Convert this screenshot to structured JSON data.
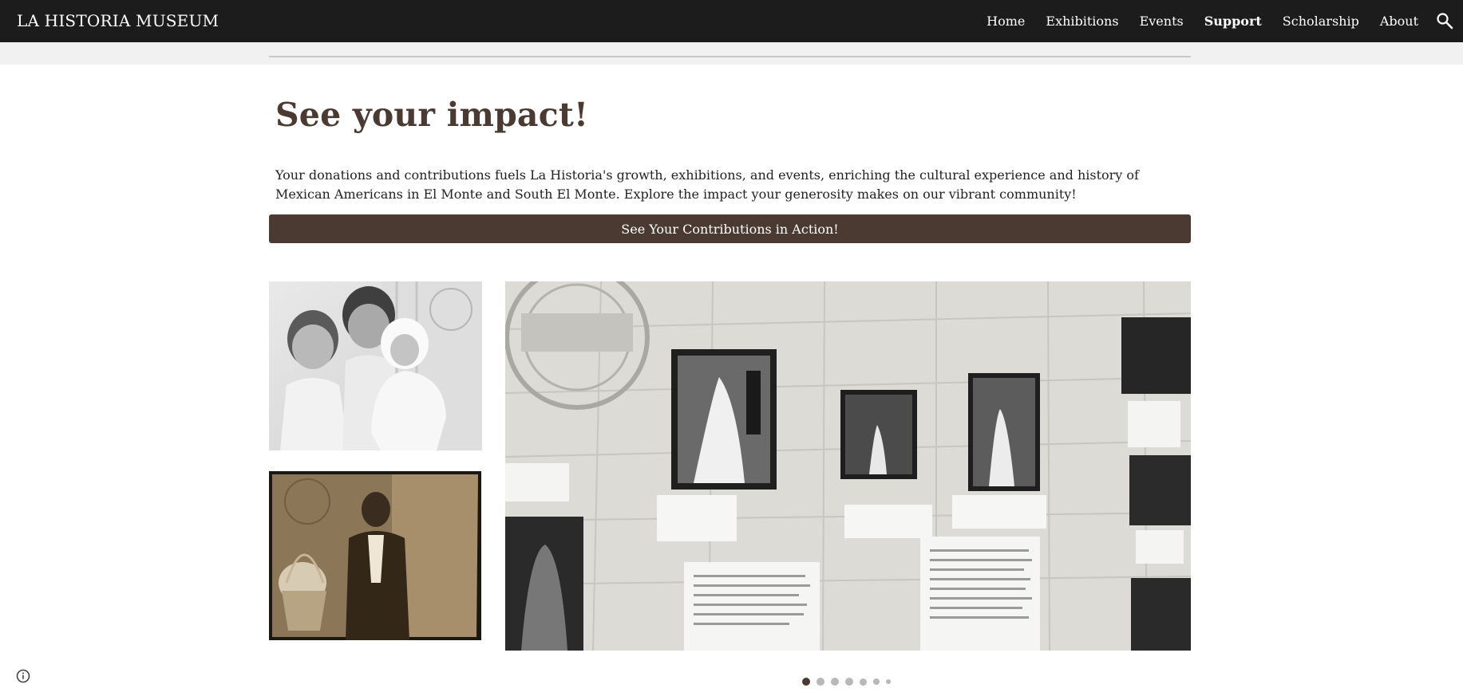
{
  "header": {
    "site_title": "LA HISTORIA MUSEUM",
    "nav": [
      "Home",
      "Exhibitions",
      "Events",
      "Support",
      "Scholarship",
      "About"
    ],
    "active_nav": "Support",
    "search_icon": "search-icon",
    "background": "#1c1c1c"
  },
  "main": {
    "heading": "See your impact!",
    "intro": "Your donations and contributions fuels La Historia's growth, exhibitions, and events, enriching the cultural experience and history of Mexican Americans in El Monte and South El Monte. Explore the impact your generosity makes on our vibrant community!",
    "cta_label": "See Your Contributions in Action!",
    "accent_color": "#4a3a31"
  },
  "carousel": {
    "slide_count": 7,
    "active_index": 0
  },
  "footer": {
    "info_icon": "info-icon"
  }
}
